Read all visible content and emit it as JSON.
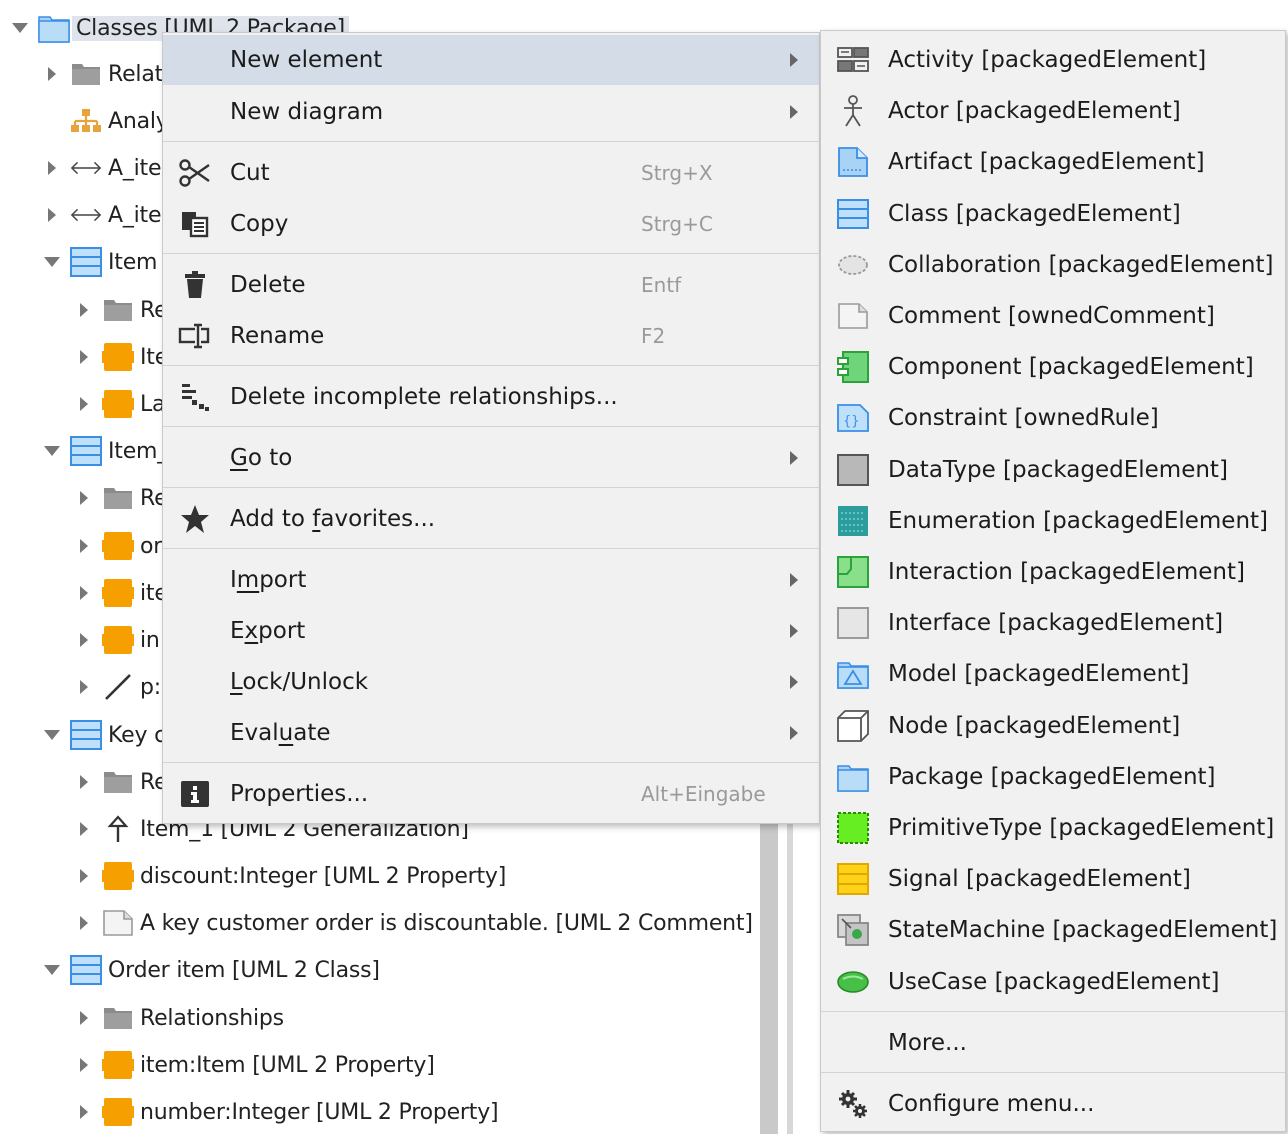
{
  "tree": {
    "rows": [
      {
        "label": "Classes [UML 2 Package]",
        "icon": "package-icon",
        "expanded": true,
        "indent": 0,
        "arrow": "down"
      },
      {
        "label": "Relati",
        "icon": "folder-icon",
        "indent": 1,
        "arrow": "right"
      },
      {
        "label": "Analy",
        "icon": "hierarchy-icon",
        "indent": 1,
        "arrow": "none"
      },
      {
        "label": "A_ite",
        "icon": "association-icon",
        "indent": 1,
        "arrow": "right"
      },
      {
        "label": "A_ite",
        "icon": "association-icon",
        "indent": 1,
        "arrow": "right"
      },
      {
        "label": "Item",
        "icon": "class-icon",
        "indent": 1,
        "arrow": "down"
      },
      {
        "label": "Re",
        "icon": "folder-icon",
        "indent": 2,
        "arrow": "right"
      },
      {
        "label": "Ite",
        "icon": "property-icon",
        "indent": 2,
        "arrow": "right"
      },
      {
        "label": "La",
        "icon": "property-icon",
        "indent": 2,
        "arrow": "right"
      },
      {
        "label": "Item_",
        "icon": "class-icon",
        "indent": 1,
        "arrow": "down"
      },
      {
        "label": "Re",
        "icon": "folder-icon",
        "indent": 2,
        "arrow": "right"
      },
      {
        "label": "or",
        "icon": "property-icon",
        "indent": 2,
        "arrow": "right"
      },
      {
        "label": "ite",
        "icon": "property-icon",
        "indent": 2,
        "arrow": "right"
      },
      {
        "label": "in",
        "icon": "property-icon",
        "indent": 2,
        "arrow": "right"
      },
      {
        "label": "p:I",
        "icon": "line-icon",
        "indent": 2,
        "arrow": "right"
      },
      {
        "label": "Key c",
        "icon": "class-icon",
        "indent": 1,
        "arrow": "down"
      },
      {
        "label": "Re",
        "icon": "folder-icon",
        "indent": 2,
        "arrow": "right"
      },
      {
        "label": "Item_1 [UML 2 Generalization]",
        "icon": "generalization-icon",
        "indent": 2,
        "arrow": "right"
      },
      {
        "label": "discount:Integer [UML 2 Property]",
        "icon": "property-icon",
        "indent": 2,
        "arrow": "right"
      },
      {
        "label": "A key customer order is discountable. [UML 2 Comment]",
        "icon": "comment-icon",
        "indent": 2,
        "arrow": "right"
      },
      {
        "label": "Order item [UML 2 Class]",
        "icon": "class-icon",
        "indent": 1,
        "arrow": "down"
      },
      {
        "label": "Relationships",
        "icon": "folder-icon",
        "indent": 2,
        "arrow": "right"
      },
      {
        "label": "item:Item [UML 2 Property]",
        "icon": "property-icon",
        "indent": 2,
        "arrow": "right"
      },
      {
        "label": "number:Integer [UML 2 Property]",
        "icon": "property-icon",
        "indent": 2,
        "arrow": "right"
      }
    ]
  },
  "context_menu": {
    "new_element": "New element",
    "new_diagram": "New diagram",
    "cut": "Cut",
    "cut_shortcut": "Strg+X",
    "copy": "Copy",
    "copy_shortcut": "Strg+C",
    "delete": "Delete",
    "delete_shortcut": "Entf",
    "rename": "Rename",
    "rename_shortcut": "F2",
    "delete_incomplete": "Delete incomplete relationships...",
    "goto_prefix": "",
    "goto_u": "G",
    "goto_rest": "o to",
    "fav_prefix": "Add to ",
    "fav_u": "f",
    "fav_rest": "avorites...",
    "import_prefix": "I",
    "import_u": "m",
    "import_rest": "port",
    "export_prefix": "E",
    "export_u": "x",
    "export_rest": "port",
    "lock_prefix": "",
    "lock_u": "L",
    "lock_rest": "ock/Unlock",
    "eval_prefix": "Eval",
    "eval_u": "u",
    "eval_rest": "ate",
    "properties": "Properties...",
    "properties_shortcut": "Alt+Eingabe"
  },
  "submenu": {
    "items": [
      {
        "label": "Activity [packagedElement]",
        "icon": "activity-icon"
      },
      {
        "label": "Actor [packagedElement]",
        "icon": "actor-icon"
      },
      {
        "label": "Artifact [packagedElement]",
        "icon": "artifact-icon"
      },
      {
        "label": "Class [packagedElement]",
        "icon": "class-icon"
      },
      {
        "label": "Collaboration [packagedElement]",
        "icon": "collaboration-icon"
      },
      {
        "label": "Comment [ownedComment]",
        "icon": "comment-icon"
      },
      {
        "label": "Component [packagedElement]",
        "icon": "component-icon"
      },
      {
        "label": "Constraint [ownedRule]",
        "icon": "constraint-icon"
      },
      {
        "label": "DataType [packagedElement]",
        "icon": "datatype-icon"
      },
      {
        "label": "Enumeration [packagedElement]",
        "icon": "enumeration-icon"
      },
      {
        "label": "Interaction [packagedElement]",
        "icon": "interaction-icon"
      },
      {
        "label": "Interface [packagedElement]",
        "icon": "interface-icon"
      },
      {
        "label": "Model [packagedElement]",
        "icon": "model-icon"
      },
      {
        "label": "Node [packagedElement]",
        "icon": "node-icon"
      },
      {
        "label": "Package [packagedElement]",
        "icon": "package-icon"
      },
      {
        "label": "PrimitiveType [packagedElement]",
        "icon": "primitivetype-icon"
      },
      {
        "label": "Signal [packagedElement]",
        "icon": "signal-icon"
      },
      {
        "label": "StateMachine [packagedElement]",
        "icon": "statemachine-icon"
      },
      {
        "label": "UseCase [packagedElement]",
        "icon": "usecase-icon"
      }
    ],
    "more": "More...",
    "configure": "Configure menu..."
  },
  "colors": {
    "menu_bg": "#f1f1f1",
    "highlight": "#d4dce8",
    "class_blue": "#3a8ee6",
    "property_orange": "#f5a000"
  }
}
